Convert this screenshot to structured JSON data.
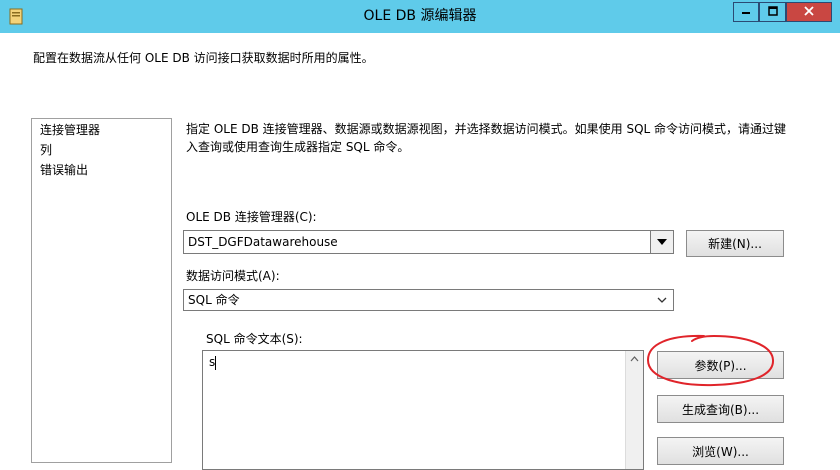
{
  "window": {
    "title": "OLE DB 源编辑器",
    "description": "配置在数据流从任何 OLE DB 访问接口获取数据时所用的属性。"
  },
  "sidebar": {
    "items": [
      {
        "label": "连接管理器"
      },
      {
        "label": "列"
      },
      {
        "label": "错误输出"
      }
    ]
  },
  "main": {
    "instruction_line1": "指定 OLE DB 连接管理器、数据源或数据源视图，并选择数据访问模式。如果使用 SQL 命令访问模式，请通过键",
    "instruction_line2": "入查询或使用查询生成器指定 SQL 命令。",
    "connection_manager": {
      "label": "OLE DB 连接管理器(C):",
      "value": "DST_DGFDatawarehouse",
      "new_button": "新建(N)..."
    },
    "access_mode": {
      "label": "数据访问模式(A):",
      "value": "SQL 命令"
    },
    "sql_command": {
      "label": "SQL 命令文本(S):",
      "value": "s"
    },
    "buttons": {
      "parameters": "参数(P)...",
      "build_query": "生成查询(B)...",
      "browse": "浏览(W)..."
    }
  },
  "colors": {
    "titlebar": "#5fcbea",
    "close_button": "#c94742",
    "annotation": "#e0242a"
  },
  "icons": {
    "app": "package-icon",
    "minimize": "minimize-icon",
    "maximize": "maximize-icon",
    "close": "close-icon",
    "dropdown": "chevron-down-icon",
    "scroll_up": "scroll-up-arrow-icon"
  }
}
